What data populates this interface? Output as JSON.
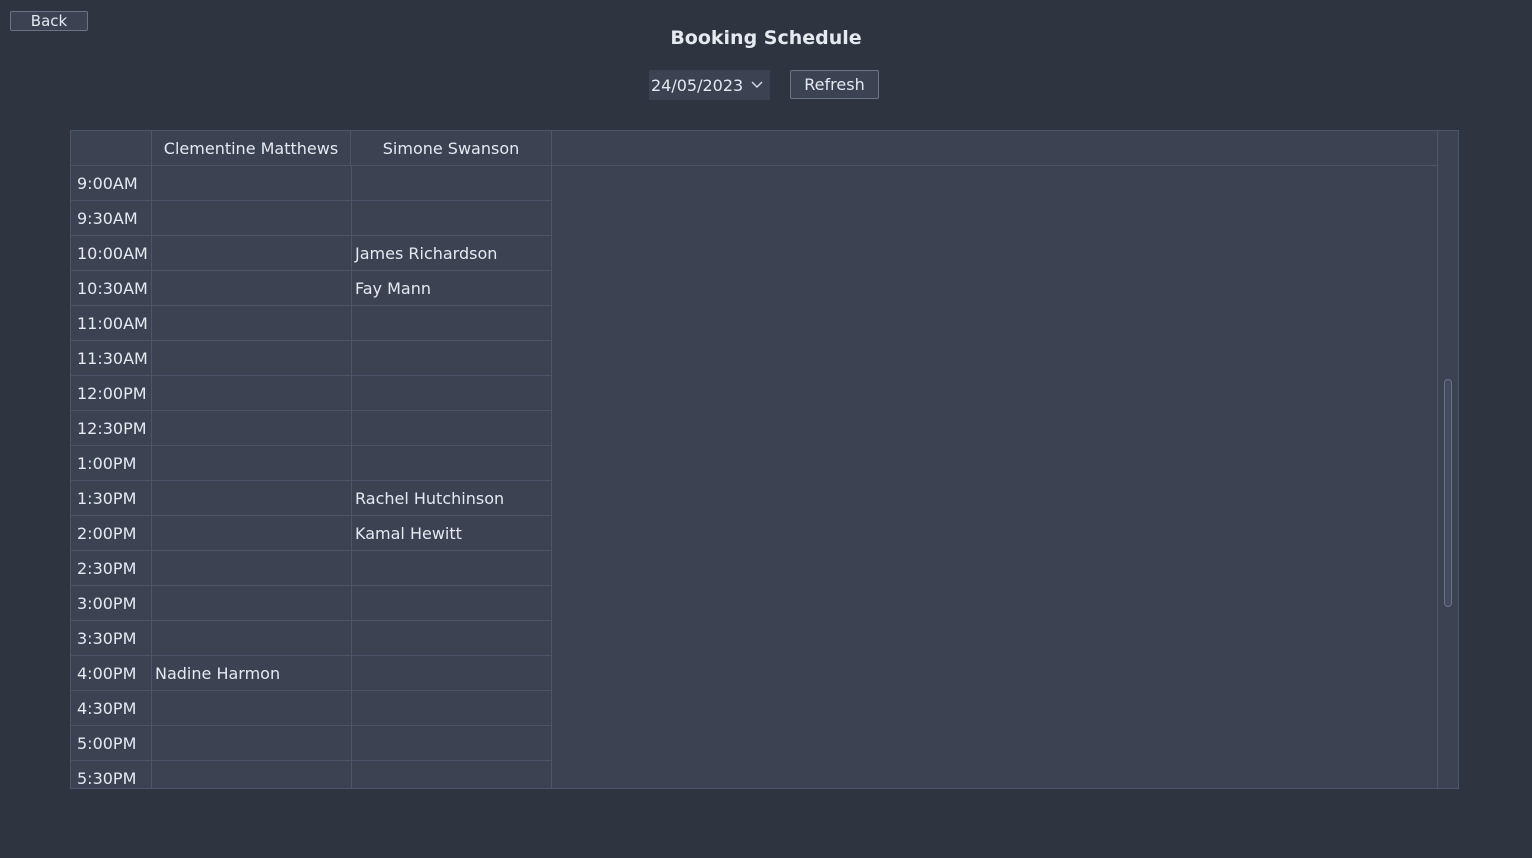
{
  "nav": {
    "back_label": "Back"
  },
  "page": {
    "title": "Booking Schedule"
  },
  "controls": {
    "date_value": "24/05/2023",
    "refresh_label": "Refresh"
  },
  "schedule": {
    "columns": [
      "Clementine Matthews",
      "Simone Swanson"
    ],
    "rows": [
      {
        "time": "9:00AM",
        "bookings": [
          "",
          ""
        ]
      },
      {
        "time": "9:30AM",
        "bookings": [
          "",
          ""
        ]
      },
      {
        "time": "10:00AM",
        "bookings": [
          "",
          "James Richardson"
        ]
      },
      {
        "time": "10:30AM",
        "bookings": [
          "",
          "Fay Mann"
        ]
      },
      {
        "time": "11:00AM",
        "bookings": [
          "",
          ""
        ]
      },
      {
        "time": "11:30AM",
        "bookings": [
          "",
          ""
        ]
      },
      {
        "time": "12:00PM",
        "bookings": [
          "",
          ""
        ]
      },
      {
        "time": "12:30PM",
        "bookings": [
          "",
          ""
        ]
      },
      {
        "time": "1:00PM",
        "bookings": [
          "",
          ""
        ]
      },
      {
        "time": "1:30PM",
        "bookings": [
          "",
          "Rachel Hutchinson"
        ]
      },
      {
        "time": "2:00PM",
        "bookings": [
          "",
          "Kamal Hewitt"
        ]
      },
      {
        "time": "2:30PM",
        "bookings": [
          "",
          ""
        ]
      },
      {
        "time": "3:00PM",
        "bookings": [
          "",
          ""
        ]
      },
      {
        "time": "3:30PM",
        "bookings": [
          "",
          ""
        ]
      },
      {
        "time": "4:00PM",
        "bookings": [
          "Nadine Harmon",
          ""
        ]
      },
      {
        "time": "4:30PM",
        "bookings": [
          "",
          ""
        ]
      },
      {
        "time": "5:00PM",
        "bookings": [
          "",
          ""
        ]
      },
      {
        "time": "5:30PM",
        "bookings": [
          "",
          ""
        ]
      }
    ]
  },
  "icons": {
    "date_dropdown": "chevron-down-icon"
  },
  "colors": {
    "background": "#2e3440",
    "panel": "#3b4252",
    "grid_line": "#4c566a",
    "text": "#e5e9f0"
  }
}
